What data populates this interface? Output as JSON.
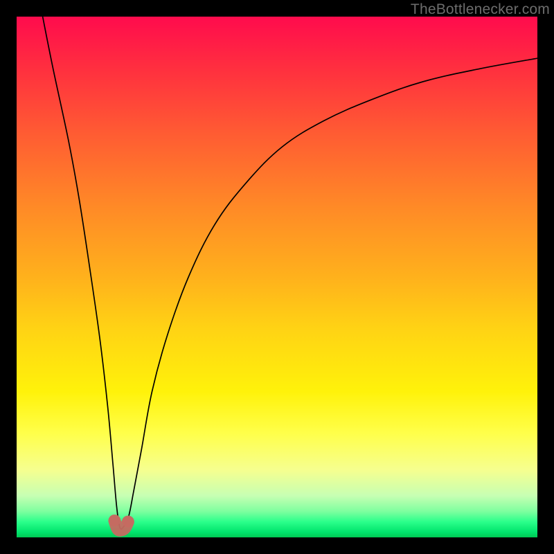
{
  "watermark": "TheBottlenecker.com",
  "colors": {
    "frame": "#000000",
    "curve": "#000000",
    "bottom_marker": "#c56a61",
    "gradient_top": "#ff0b4d",
    "gradient_bottom": "#00c954"
  },
  "chart_data": {
    "type": "line",
    "title": "",
    "xlabel": "",
    "ylabel": "",
    "xlim": [
      0,
      100
    ],
    "ylim": [
      0,
      100
    ],
    "series": [
      {
        "name": "bottleneck-curve",
        "x": [
          5,
          7,
          10,
          12,
          14,
          16,
          17.5,
          18.5,
          19.2,
          19.8,
          20.5,
          21.5,
          22.5,
          24,
          26,
          29,
          33,
          38,
          44,
          51,
          59,
          68,
          78,
          89,
          100
        ],
        "y": [
          100,
          90,
          76,
          65,
          52,
          38,
          25,
          14,
          6,
          2,
          2,
          4,
          9,
          17,
          28,
          39,
          50,
          60,
          68,
          75,
          80,
          84,
          87.5,
          90,
          92
        ]
      }
    ],
    "highlight": {
      "name": "optimal-range",
      "x": [
        18.8,
        19.4,
        20.1,
        20.8,
        21.4
      ],
      "y": [
        3.2,
        1.6,
        1.4,
        1.8,
        3.0
      ]
    },
    "background": {
      "type": "vertical-gradient",
      "stops": [
        {
          "pos": 0.0,
          "color": "#ff0b4d"
        },
        {
          "pos": 0.5,
          "color": "#ffb11c"
        },
        {
          "pos": 0.8,
          "color": "#ffff4a"
        },
        {
          "pos": 0.95,
          "color": "#7eff9f"
        },
        {
          "pos": 1.0,
          "color": "#00c954"
        }
      ]
    }
  }
}
